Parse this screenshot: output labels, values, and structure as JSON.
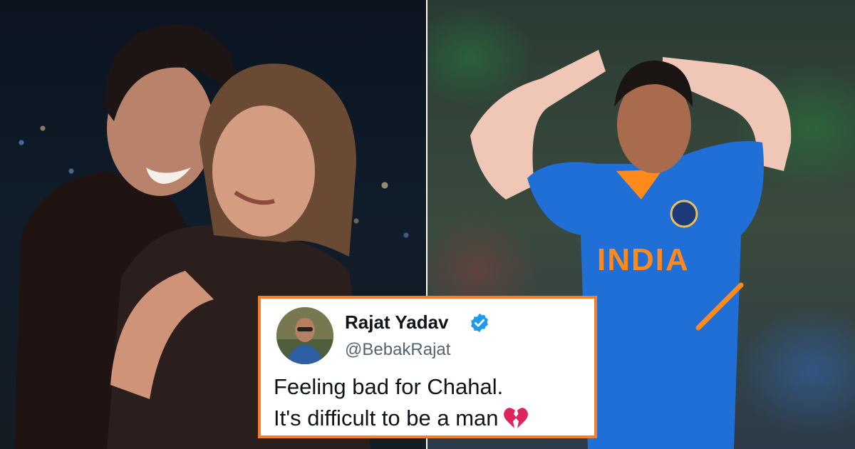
{
  "tweet": {
    "display_name": "Rajat Yadav",
    "handle": "@BebakRajat",
    "text_line_1": "Feeling bad for Chahal.",
    "text_line_2": "It's difficult to be a man",
    "emoji_icon": "broken-heart-icon",
    "verified_icon": "verified-badge-icon"
  },
  "jersey": {
    "text": "INDIA"
  },
  "colors": {
    "card_border": "#f37f2a",
    "verified_blue": "#1d9bf0",
    "heart_red": "#e0245e",
    "jersey_blue": "#1f6fd6",
    "jersey_orange": "#ff8a1c"
  }
}
